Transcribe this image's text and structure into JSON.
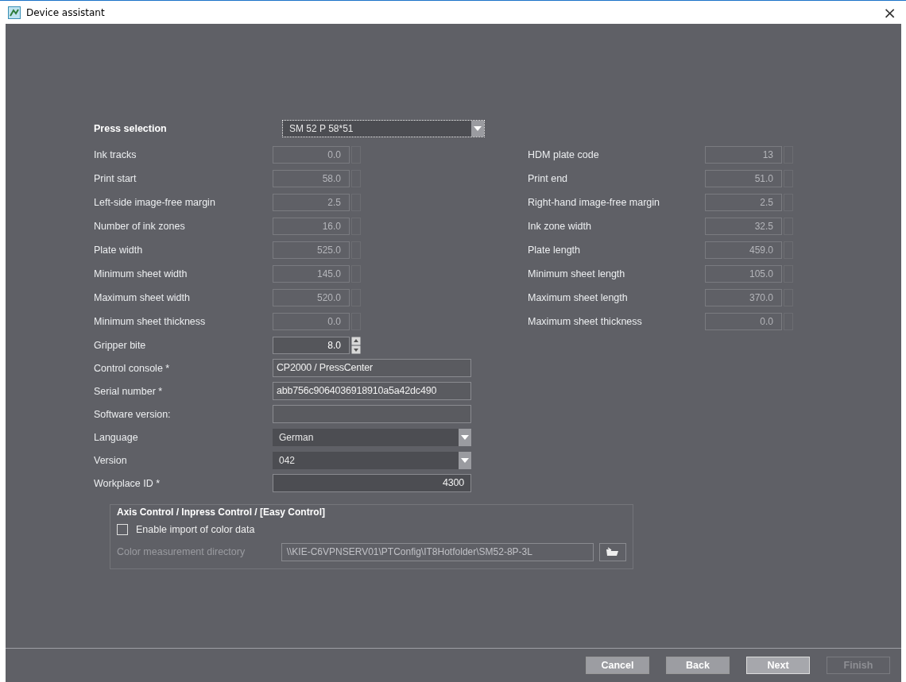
{
  "window": {
    "title": "Device assistant",
    "close": "×"
  },
  "press_selection": {
    "label": "Press selection",
    "value": "SM 52 P 58*51",
    "focused": true
  },
  "grid_rows": [
    {
      "left": {
        "label": "Ink tracks",
        "value": "0.0",
        "kind": "readonly"
      },
      "right": {
        "label": "HDM plate code",
        "value": "13",
        "kind": "readonly"
      }
    },
    {
      "left": {
        "label": "Print start",
        "value": "58.0",
        "kind": "readonly"
      },
      "right": {
        "label": "Print end",
        "value": "51.0",
        "kind": "readonly"
      }
    },
    {
      "left": {
        "label": "Left-side image-free margin",
        "value": "2.5",
        "kind": "readonly"
      },
      "right": {
        "label": "Right-hand image-free margin",
        "value": "2.5",
        "kind": "readonly"
      }
    },
    {
      "left": {
        "label": "Number of ink zones",
        "value": "16.0",
        "kind": "readonly"
      },
      "right": {
        "label": "Ink zone width",
        "value": "32.5",
        "kind": "readonly"
      }
    },
    {
      "left": {
        "label": "Plate width",
        "value": "525.0",
        "kind": "readonly"
      },
      "right": {
        "label": "Plate length",
        "value": "459.0",
        "kind": "readonly"
      }
    },
    {
      "left": {
        "label": "Minimum sheet width",
        "value": "145.0",
        "kind": "readonly"
      },
      "right": {
        "label": "Minimum sheet length",
        "value": "105.0",
        "kind": "readonly"
      }
    },
    {
      "left": {
        "label": "Maximum sheet width",
        "value": "520.0",
        "kind": "readonly"
      },
      "right": {
        "label": "Maximum sheet length",
        "value": "370.0",
        "kind": "readonly"
      }
    },
    {
      "left": {
        "label": "Minimum sheet thickness",
        "value": "0.0",
        "kind": "readonly"
      },
      "right": {
        "label": "Maximum sheet thickness",
        "value": "0.0",
        "kind": "readonly"
      }
    },
    {
      "left": {
        "label": "Gripper bite",
        "value": "8.0",
        "kind": "spinner"
      }
    }
  ],
  "fields": [
    {
      "label": "Control console *",
      "value": "CP2000 / PressCenter",
      "kind": "text"
    },
    {
      "label": "Serial number *",
      "value": "abb756c9064036918910a5a42dc490",
      "kind": "text"
    },
    {
      "label": "Software version:",
      "kind": "text"
    },
    {
      "label": "Language",
      "value": "German",
      "kind": "dropdown"
    },
    {
      "label": "Version",
      "value": "042",
      "kind": "dropdown"
    },
    {
      "label": "Workplace ID *",
      "value": "4300",
      "kind": "number"
    }
  ],
  "group": {
    "title": "Axis Control / Inpress Control / [Easy Control]",
    "checkbox": {
      "label": "Enable import of color data",
      "checked": false
    },
    "directory": {
      "label": "Color measurement directory",
      "value": "\\\\KIE-C6VPNSERV01\\PTConfig\\IT8Hotfolder\\SM52-8P-3L",
      "disabled": true
    }
  },
  "buttons": [
    {
      "label": "Cancel",
      "default": false,
      "disabled": false
    },
    {
      "label": "Back",
      "default": false,
      "disabled": false
    },
    {
      "label": "Next",
      "default": true,
      "disabled": false
    },
    {
      "label": "Finish",
      "default": false,
      "disabled": true
    }
  ]
}
